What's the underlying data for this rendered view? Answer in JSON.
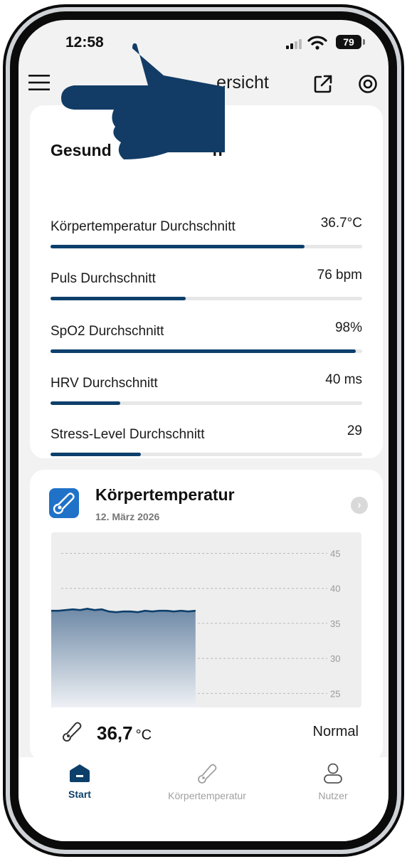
{
  "status_bar": {
    "time": "12:58",
    "battery": "79"
  },
  "header": {
    "title_partial": "ersicht"
  },
  "metrics_card": {
    "title_partial": "Gesund",
    "title_partial_2": "n",
    "items": [
      {
        "label": "Körpertemperatur Durchschnitt",
        "value": "36.7°C",
        "level": 0.816
      },
      {
        "label": "Puls Durchschnitt",
        "value": "76 bpm",
        "level": 0.434
      },
      {
        "label": "SpO2 Durchschnitt",
        "value": "98%",
        "level": 0.98
      },
      {
        "label": "HRV Durchschnitt",
        "value": "40 ms",
        "level": 0.224
      },
      {
        "label": "Stress-Level Durchschnitt",
        "value": "29",
        "level": 0.29
      }
    ]
  },
  "temperature_card": {
    "title": "Körpertemperatur",
    "date": "12. März 2026",
    "reading_value": "36,7",
    "reading_unit": "°C",
    "reading_status": "Normal",
    "icon_color": "#1f72c7"
  },
  "chart_data": {
    "type": "area",
    "y_ticks": [
      "45",
      "40",
      "35",
      "30",
      "25"
    ],
    "ylim": [
      23,
      48
    ],
    "grid": true,
    "x": [
      0,
      1,
      2,
      3,
      4,
      5,
      6,
      7,
      8,
      9,
      10,
      11,
      12,
      13,
      14,
      15,
      16,
      17,
      18,
      19,
      20
    ],
    "xlim": [
      0,
      43
    ],
    "values": [
      36.8,
      36.8,
      36.9,
      37.0,
      36.9,
      37.1,
      36.9,
      37.0,
      36.7,
      36.6,
      36.7,
      36.7,
      36.6,
      36.8,
      36.7,
      36.8,
      36.8,
      36.7,
      36.8,
      36.7,
      36.8
    ]
  },
  "tabbar": {
    "items": [
      {
        "label": "Start",
        "active": true
      },
      {
        "label": "Körpertemperatur",
        "active": false
      },
      {
        "label": "Nutzer",
        "active": false
      }
    ]
  },
  "colors": {
    "accent": "#0d3f6b",
    "track": "#e7e7e7",
    "background": "#f2f2f2",
    "redaction": "#123c66"
  }
}
